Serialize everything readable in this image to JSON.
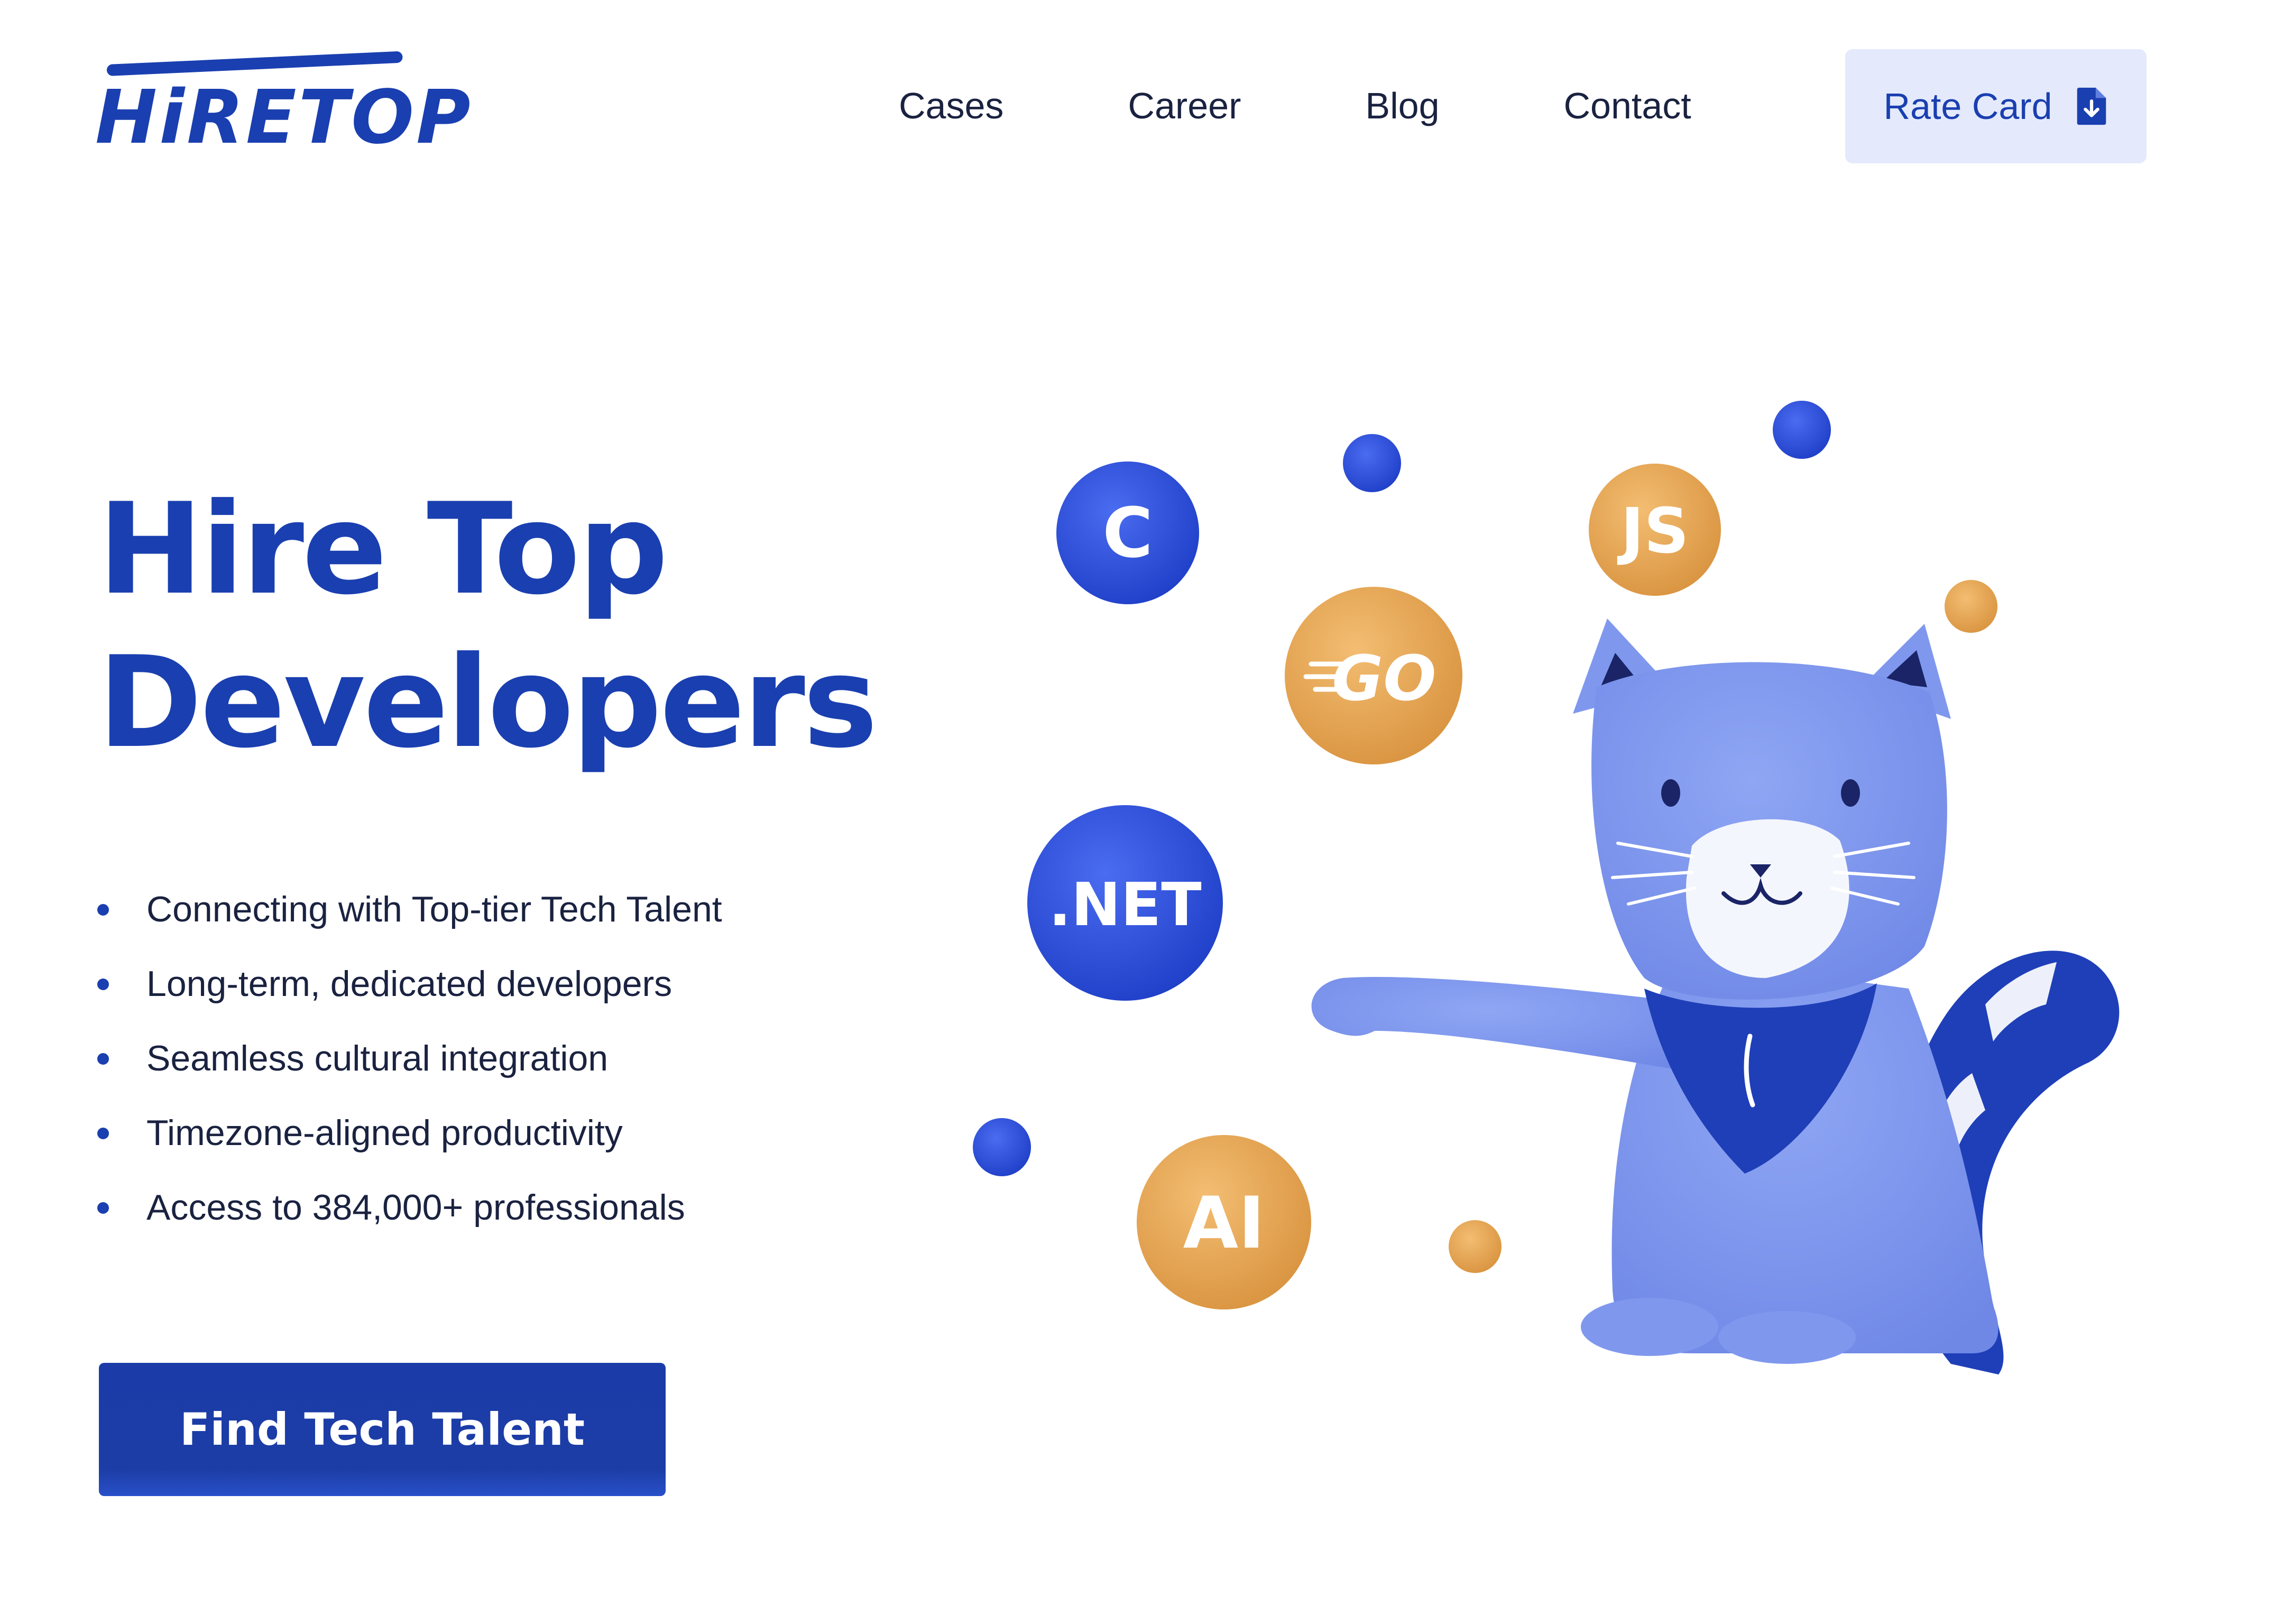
{
  "header": {
    "logo_text": "HiRETOP",
    "nav": [
      "Cases",
      "Career",
      "Blog",
      "Contact"
    ],
    "rate_card_label": "Rate Card",
    "rate_card_icon": "document-download-icon"
  },
  "hero": {
    "title_line1": "Hire Top",
    "title_line2": "Developers",
    "features": [
      "Connecting with Top-tier Tech Talent",
      "Long-term, dedicated developers",
      "Seamless cultural integration",
      "Timezone-aligned productivity",
      "Access to 384,000+ professionals"
    ],
    "cta_label": "Find Tech Talent"
  },
  "illustration": {
    "bubbles": [
      {
        "label": "C",
        "color": "#2b4fd8"
      },
      {
        "label": "JS",
        "color": "#e9a754"
      },
      {
        "label": "GO",
        "color": "#e9a754"
      },
      {
        "label": ".NET",
        "color": "#2b4fd8"
      },
      {
        "label": "AI",
        "color": "#e9a754"
      }
    ],
    "mascot": "cat-mascot-illustration"
  },
  "colors": {
    "brand_blue": "#1a3fb0",
    "accent_orange": "#e9a754",
    "cat_body": "#7f98ee",
    "rate_card_bg": "#e4eafc",
    "text_dark": "#1a2240"
  }
}
